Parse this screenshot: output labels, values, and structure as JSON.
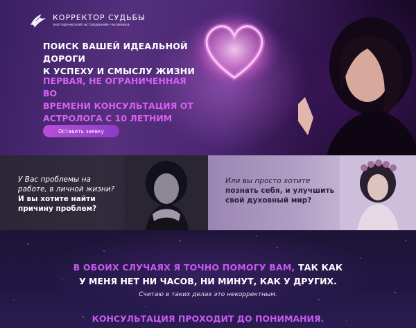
{
  "logo": {
    "title": "КОРРЕКТОР СУДЬБЫ",
    "subtitle": "эзотерический астродизайн человека",
    "icon": "bird-logo-icon"
  },
  "hero": {
    "headline_line1": "ПОИСК ВАШЕЙ ИДЕАЛЬНОЙ ДОРОГИ",
    "headline_line2": "К УСПЕХУ И СМЫСЛУ ЖИЗНИ",
    "offer_line1": "ПЕРВАЯ, НЕ ОГРАНИЧЕННАЯ ВО",
    "offer_line2": "ВРЕМЕНИ КОНСУЛЬТАЦИЯ ОТ",
    "offer_line3": "АСТРОЛОГА С 10 ЛЕТНИМ СТАЖЕМ",
    "cta_label": "Оставить заявку",
    "accent_color": "#d760f2"
  },
  "panels": {
    "left": {
      "line1": "У Вас проблемы на",
      "line2": "работе, в личной жизни?",
      "bold1": "И вы хотите найти",
      "bold2": "причину проблем?"
    },
    "right": {
      "line1": "Или вы просто хотите",
      "bold1": "познать себя, и улучшить",
      "bold2": "свой духовный мир?"
    }
  },
  "bottom": {
    "line1_highlight": "В ОБОИХ СЛУЧАЯХ Я ТОЧНО ПОМОГУ ВАМ,",
    "line1_rest": " ТАК КАК",
    "line2": "У МЕНЯ НЕТ НИ ЧАСОВ, НИ МИНУТ, КАК У ДРУГИХ.",
    "line3": "Считаю в таких делах это некорректным.",
    "line4": "КОНСУЛЬТАЦИЯ ПРОХОДИТ ДО ПОНИМАНИЯ."
  }
}
